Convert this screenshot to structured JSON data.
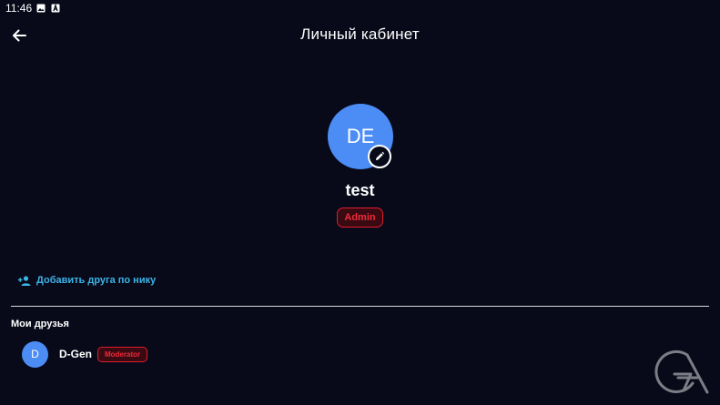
{
  "status_bar": {
    "time": "11:46",
    "icons": [
      "image-icon",
      "text-icon"
    ]
  },
  "app_bar": {
    "title": "Личный кабинет",
    "back_icon": "arrow-left-icon"
  },
  "profile": {
    "initials": "DE",
    "avatar_color": "#4c8cf5",
    "username": "test",
    "role": "Admin",
    "edit_icon": "pencil-icon"
  },
  "actions": {
    "add_friend_label": "Добавить друга по нику",
    "add_friend_icon": "person-add-icon"
  },
  "friends": {
    "heading": "Мои друзья",
    "items": [
      {
        "initial": "D",
        "name": "D-Gen",
        "role": "Moderator"
      }
    ]
  },
  "colors": {
    "background": "#080a1a",
    "accent": "#3cb4e6",
    "badge_red": "#e21c2c"
  }
}
